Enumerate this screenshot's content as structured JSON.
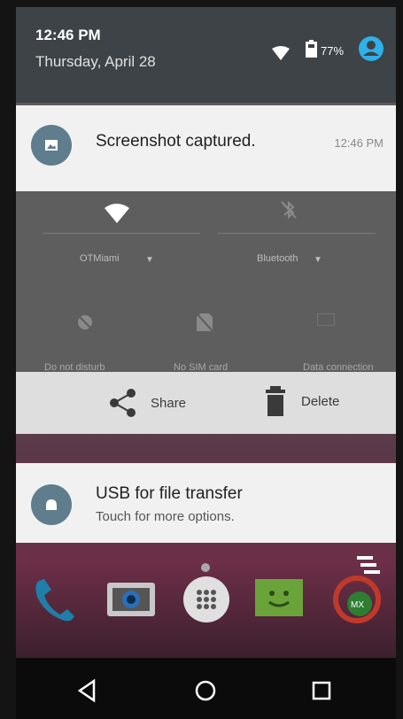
{
  "status": {
    "time": "12:46 PM",
    "date": "Thursday, April 28",
    "battery_percent": "77%",
    "icons": [
      "wifi-icon",
      "battery-icon",
      "profile-icon"
    ]
  },
  "notifications": [
    {
      "title": "Screenshot captured.",
      "time": "12:46 PM",
      "icon": "image-icon"
    },
    {
      "title": "USB for file transfer",
      "subtitle": "Touch for more options.",
      "icon": "android-icon"
    }
  ],
  "quick_settings": {
    "wifi_label": "OTMiami",
    "bluetooth_label": "Bluetooth",
    "tiles": [
      {
        "label": "Do not disturb",
        "icon": "dnd-off-icon"
      },
      {
        "label": "No SIM card",
        "icon": "no-sim-icon"
      },
      {
        "label": "Data connection",
        "icon": "data-icon"
      }
    ]
  },
  "actions": {
    "share_label": "Share",
    "delete_label": "Delete"
  },
  "dock": {
    "apps": [
      "phone-icon",
      "camera-icon",
      "app-drawer-icon",
      "messaging-icon",
      "mx-player-icon"
    ]
  },
  "nav": [
    "back-icon",
    "home-icon",
    "recents-icon"
  ],
  "colors": {
    "header_bg": "#3d4347",
    "card_bg": "#f1f1f1",
    "avatar_bg": "#5f7d8c",
    "profile_accent": "#2fb0e6"
  }
}
